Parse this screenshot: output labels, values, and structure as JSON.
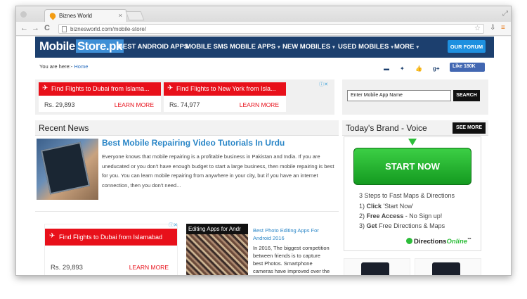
{
  "browser": {
    "tab_title": "Biznes World",
    "tab_close": "×",
    "url": "biznesworld.com/mobile-store/",
    "nav_back": "←",
    "nav_forward": "→",
    "nav_reload": "C",
    "star": "☆",
    "ext_download": "⇩",
    "ext_menu": "≡",
    "window_controls": "⤢"
  },
  "site": {
    "logo_part1": "Mobile",
    "logo_part2": "Store.pk",
    "nav": [
      {
        "label": "BEST ANDROID APPS",
        "has_caret": false
      },
      {
        "label": "MOBILE SMS",
        "has_caret": false
      },
      {
        "label": "MOBILE APPS",
        "has_caret": true
      },
      {
        "label": "NEW MOBILES",
        "has_caret": true
      },
      {
        "label": "USED MOBILES",
        "has_caret": true
      },
      {
        "label": "MORE",
        "has_caret": true
      }
    ],
    "caret": "▾",
    "forum_button": "OUR FORUM"
  },
  "breadcrumb": {
    "prefix": "You are here:-",
    "home": "Home"
  },
  "social": {
    "icons": [
      "chat-icon",
      "twitter-icon",
      "thumbs-up-icon",
      "google-plus-icon"
    ],
    "glyphs": [
      "▬",
      "✦",
      "👍",
      "g+"
    ],
    "like_label": "Like 180K"
  },
  "top_ads": [
    {
      "headline": "Find Flights to Dubai from Islama...",
      "price": "Rs. 29,893",
      "cta": "LEARN MORE"
    },
    {
      "headline": "Find Flights to New York from Isla...",
      "price": "Rs. 74,977",
      "cta": "LEARN MORE"
    }
  ],
  "ad_choices": "ⓘ✕",
  "plane_glyph": "✈",
  "search": {
    "placeholder": "Enter Mobile App Name",
    "button": "SEARCH"
  },
  "recent_news": {
    "heading": "Recent News",
    "article": {
      "title": "Best Mobile Repairing Video Tutorials In Urdu",
      "excerpt": "Everyone knows that mobile repairing is a profitable business in Pakistan and India. If you are uneducated or you don't have enough budget to start a large business, then mobile repairing is best for you. You can learn mobile repairing from anywhere in your city, but if you have an internet connection, then you don't need..."
    }
  },
  "bottom_ad": {
    "headline": "Find Flights to Dubai from Islamabad",
    "price": "Rs. 29,893",
    "cta": "LEARN MORE"
  },
  "photo_post": {
    "image_caption": "Editing Apps for Andr",
    "title": "Best Photo Editing Apps For Android 2016",
    "excerpt": "In 2016, The biggest competition between friends is to capture best Photos. Smartphone cameras have improved over the past few"
  },
  "brand": {
    "heading": "Today's Brand - Voice",
    "see_more": "SEE MORE",
    "ad": {
      "button": "START NOW",
      "line1": "3 Steps to Fast Maps & Directions",
      "step1_num": "1)",
      "step1_bold": "Click",
      "step1_rest": "'Start Now'",
      "step2_num": "2)",
      "step2_bold": "Free Access",
      "step2_rest": "- No Sign up!",
      "step3_num": "3)",
      "step3_bold": "Get",
      "step3_rest": "Free Directions & Maps",
      "logo_a": "Directions",
      "logo_b": "Online",
      "logo_tm": "™"
    }
  }
}
